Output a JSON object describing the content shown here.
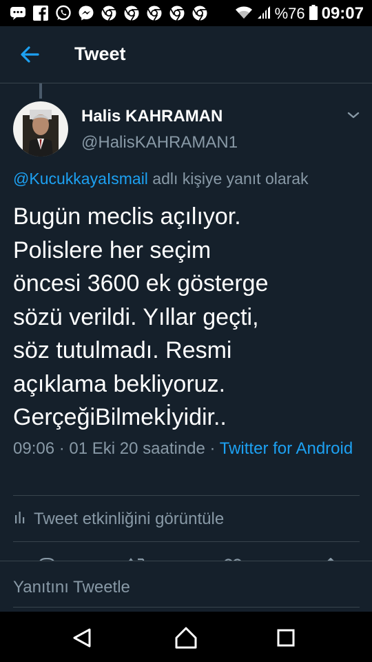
{
  "status_bar": {
    "icons": [
      "message-icon",
      "facebook-icon",
      "whatsapp-icon",
      "messenger-icon",
      "chrome-icon",
      "chrome-icon",
      "chrome-icon",
      "chrome-icon",
      "chrome-icon"
    ],
    "battery": "%76",
    "time": "09:07"
  },
  "header": {
    "title": "Tweet"
  },
  "author": {
    "name": "Halis KAHRAMAN",
    "handle": "@HalisKAHRAMAN1"
  },
  "reply": {
    "mention": "@KucukkayaIsmail",
    "suffix": " adlı kişiye yanıt olarak"
  },
  "tweet": {
    "lines": [
      "Bugün meclis açılıyor.",
      "Polislere her seçim",
      "öncesi 3600 ek gösterge",
      "sözü verildi. Yıllar geçti,",
      "söz tutulmadı. Resmi",
      "açıklama bekliyoruz.",
      "GerçeğiBilmekİyidir.."
    ]
  },
  "meta": {
    "time_date": "09:06 · 01 Eki 20 saatinde · ",
    "source": "Twitter for Android"
  },
  "activity": {
    "label": "Tweet etkinliğini görüntüle"
  },
  "compose": {
    "placeholder": "Yanıtını Tweetle"
  },
  "colors": {
    "background": "#15202b",
    "accent": "#1da1f2",
    "secondary_text": "#8899a6",
    "divider": "#38444d"
  }
}
